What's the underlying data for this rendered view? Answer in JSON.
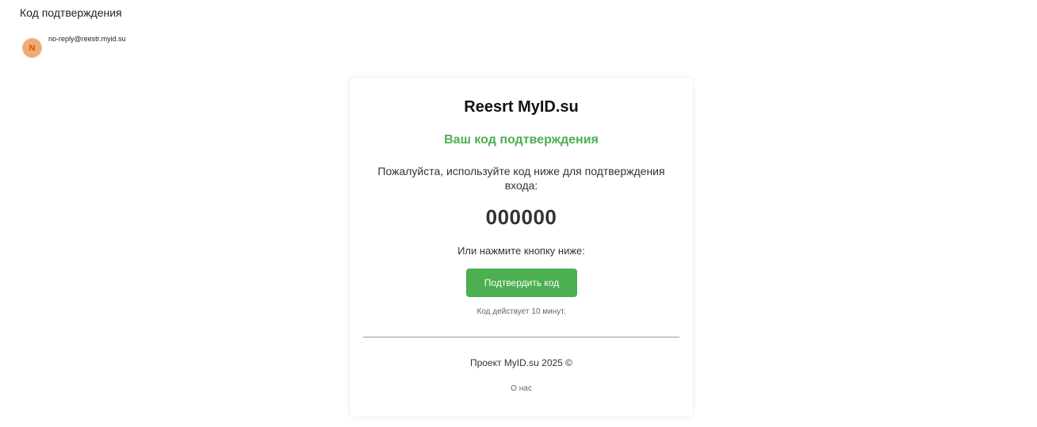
{
  "email": {
    "subject": "Код подтверждения",
    "sender": {
      "avatar_letter": "N",
      "address": "no-reply@reestr.myid.su"
    }
  },
  "message": {
    "brand": "Reesrt MyID.su",
    "heading": "Ваш код подтверждения",
    "instruction": "Пожалуйста, используйте код ниже для подтверждения входа:",
    "code": "000000",
    "or_text": "Или нажмите кнопку ниже:",
    "confirm_button_label": "Подтвердить код",
    "validity_note": "Код действует 10 минут.",
    "footer_text": "Проект MyID.su 2025 ©",
    "about_link": "О нас"
  },
  "colors": {
    "accent": "#4caf50",
    "avatar_bg": "#f6a96e",
    "avatar_text": "#c8561a"
  }
}
